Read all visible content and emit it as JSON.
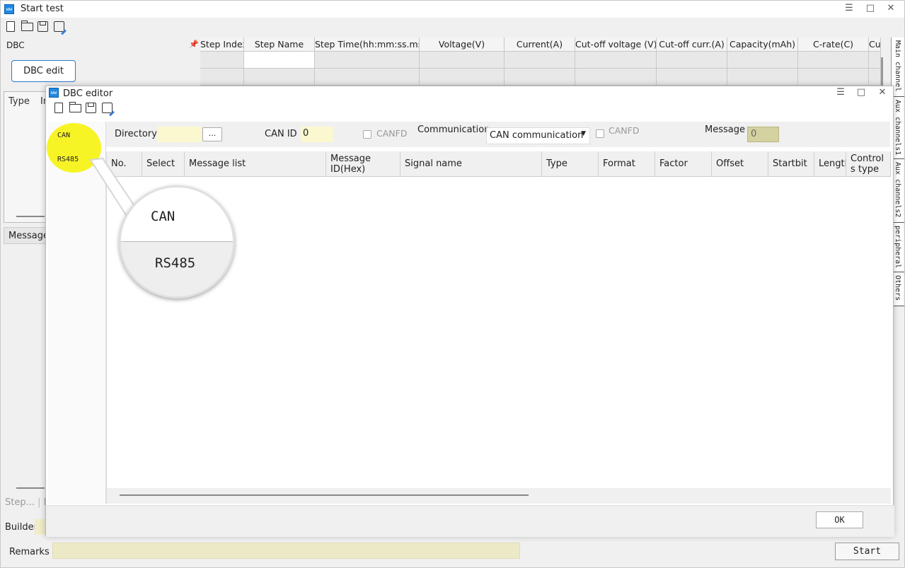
{
  "main_window": {
    "title": "Start test",
    "controls": {
      "menu": "☰",
      "maximize": "□",
      "close": "✕"
    },
    "left_panel": {
      "dbc_label": "DBC",
      "dbc_edit_button": "DBC edit",
      "type_column": "Type",
      "in_column": "In",
      "message_tab": "Message"
    },
    "step_grid": {
      "columns": [
        "Step Index",
        "Step Name",
        "Step Time(hh:mm:ss.ms)",
        "Voltage(V)",
        "Current(A)",
        "Cut-off voltage (V)",
        "Cut-off curr.(A)",
        "Capacity(mAh)",
        "C-rate(C)",
        "Cu"
      ]
    },
    "right_tabs": [
      "Main channel",
      "Aux channels1",
      "Aux channels2",
      "peripheral",
      "Others"
    ],
    "bottom": {
      "step_tab": "Step...",
      "b_tab": "B",
      "builder_label": "Builder",
      "remarks_label": "Remarks",
      "start_button": "Start"
    }
  },
  "dbc_editor": {
    "title": "DBC editor",
    "side_items": {
      "can": "CAN",
      "rs485": "RS485"
    },
    "form": {
      "directory_label": "Directory",
      "directory_value": "",
      "browse_button": "...",
      "can_id_label": "CAN ID",
      "can_id_value": "0",
      "canfd_label_1": "CANFD",
      "communication_label": "Communication",
      "communication_value": "CAN communication",
      "canfd_label_2": "CANFD",
      "message_label": "Message",
      "message_value": "0"
    },
    "grid_columns": [
      "No.",
      "Select",
      "Message list",
      "Message ID(Hex)",
      "Signal name",
      "Type",
      "Format",
      "Factor",
      "Offset",
      "Startbit",
      "Length",
      "Control s type"
    ],
    "ok_button": "OK"
  },
  "zoom_callout": {
    "can": "CAN",
    "rs485": "RS485"
  },
  "colors": {
    "highlight": "#f7f31a",
    "field_yellow": "#fbf8d0",
    "accent_blue": "#2a79c9"
  }
}
